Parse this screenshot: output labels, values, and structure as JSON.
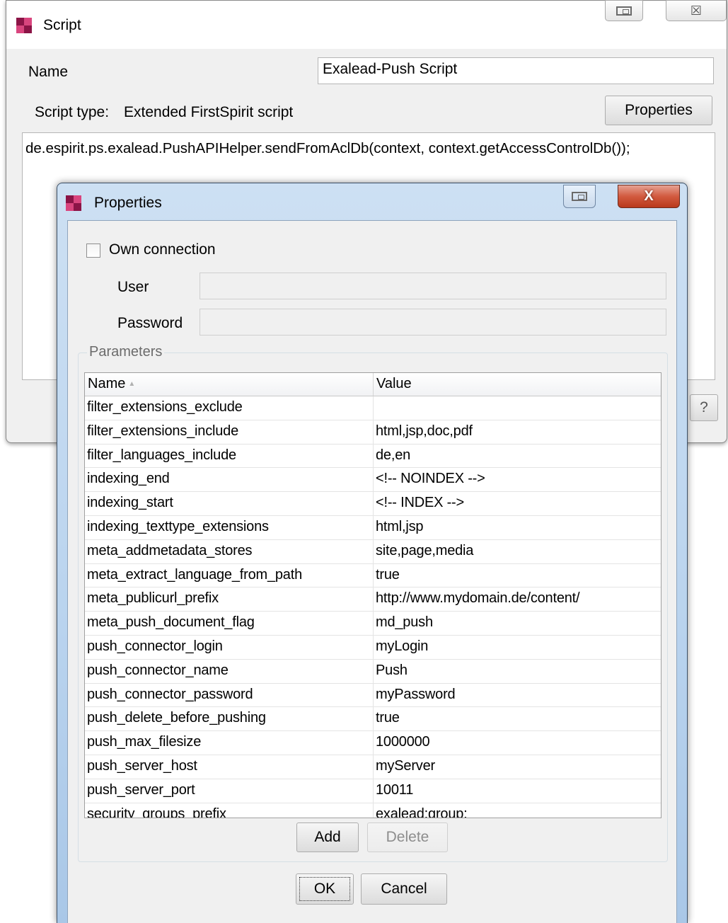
{
  "script_window": {
    "title": "Script",
    "name_label": "Name",
    "name_value": "Exalead-Push Script",
    "script_type_label": "Script type:",
    "script_type_value": "Extended FirstSpirit script",
    "properties_button": "Properties",
    "script_code": "de.espirit.ps.exalead.PushAPIHelper.sendFromAclDb(context, context.getAccessControlDb());",
    "help_button": "?",
    "close_glyph": "☒"
  },
  "properties_dialog": {
    "title": "Properties",
    "close_glyph": "X",
    "own_connection_label": "Own connection",
    "own_connection_checked": false,
    "user_label": "User",
    "user_value": "",
    "password_label": "Password",
    "password_value": "",
    "parameters_legend": "Parameters",
    "table": {
      "columns": [
        "Name",
        "Value"
      ],
      "sort_indicator": "▲",
      "rows": [
        {
          "name": "filter_extensions_exclude",
          "value": ""
        },
        {
          "name": "filter_extensions_include",
          "value": "html,jsp,doc,pdf"
        },
        {
          "name": "filter_languages_include",
          "value": "de,en"
        },
        {
          "name": "indexing_end",
          "value": "<!-- NOINDEX -->"
        },
        {
          "name": "indexing_start",
          "value": "<!-- INDEX -->"
        },
        {
          "name": "indexing_texttype_extensions",
          "value": "html,jsp"
        },
        {
          "name": "meta_addmetadata_stores",
          "value": "site,page,media"
        },
        {
          "name": "meta_extract_language_from_path",
          "value": "true"
        },
        {
          "name": "meta_publicurl_prefix",
          "value": "http://www.mydomain.de/content/"
        },
        {
          "name": "meta_push_document_flag",
          "value": "md_push"
        },
        {
          "name": "push_connector_login",
          "value": "myLogin"
        },
        {
          "name": "push_connector_name",
          "value": "Push"
        },
        {
          "name": "push_connector_password",
          "value": "myPassword"
        },
        {
          "name": "push_delete_before_pushing",
          "value": "true"
        },
        {
          "name": "push_max_filesize",
          "value": "1000000"
        },
        {
          "name": "push_server_host",
          "value": "myServer"
        },
        {
          "name": "push_server_port",
          "value": "10011"
        },
        {
          "name": "security_groups_prefix",
          "value": "exalead:group:"
        }
      ]
    },
    "add_button": "Add",
    "delete_button": "Delete",
    "ok_button": "OK",
    "cancel_button": "Cancel"
  },
  "colors": {
    "firstspirit_icon_dark": "#8b1446",
    "firstspirit_icon_light": "#d9457e",
    "close_button_red": "#c94a2e",
    "dialog_frame_blue": "#b9d3ee"
  }
}
